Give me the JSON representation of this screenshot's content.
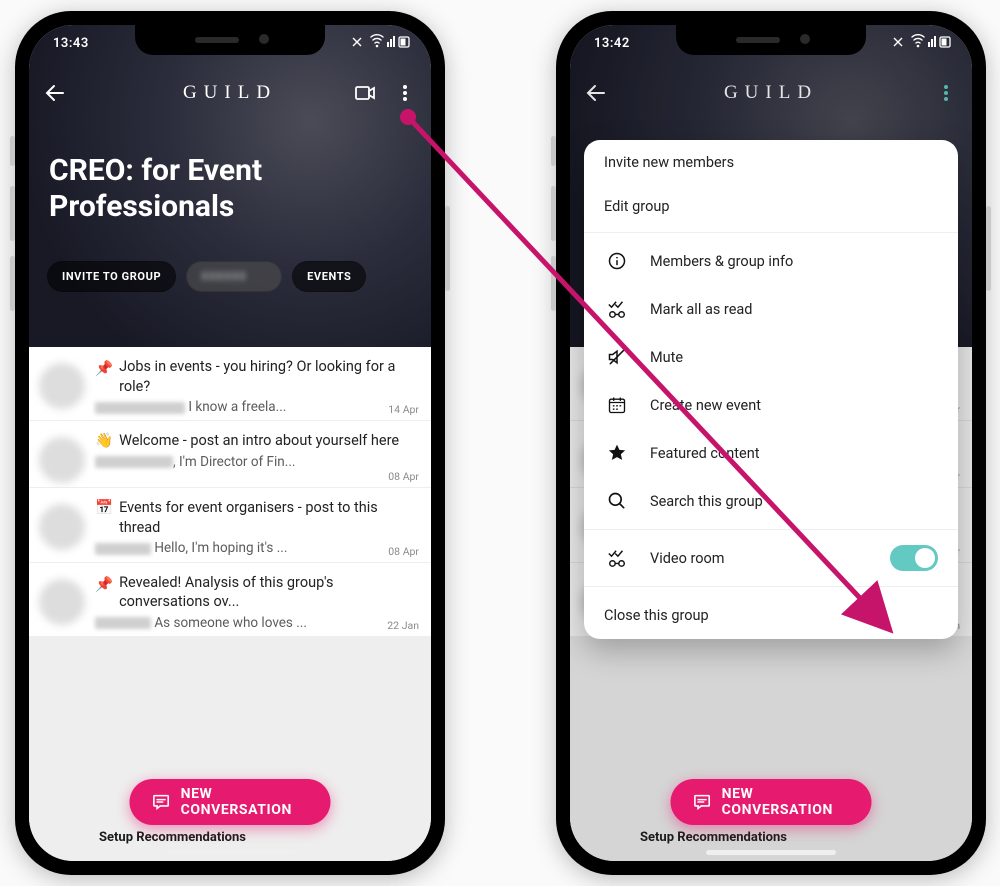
{
  "status": {
    "time_left": "13:43",
    "time_right": "13:42"
  },
  "brand": "GUILD",
  "hero_title_line1": "CREO: for Event",
  "hero_title_line2": "Professionals",
  "pills": {
    "invite": "INVITE TO GROUP",
    "events": "EVENTS"
  },
  "fab_label": "NEW CONVERSATION",
  "setup_hint": "Setup Recommendations",
  "posts": [
    {
      "title": "Jobs in events - you hiring? Or looking for a role?",
      "snippet": "I know a freela...",
      "date": "14 Apr",
      "icon": "pin"
    },
    {
      "title": "Welcome - post an intro about yourself here",
      "snippet": ", I'm Director of Fin...",
      "date": "08 Apr",
      "icon": "wave"
    },
    {
      "title": "Events for event organisers - post to this thread",
      "snippet": "Hello, I'm hoping it's ...",
      "date": "08 Apr",
      "icon": "cal"
    },
    {
      "title": "Revealed! Analysis of this group's conversations ov...",
      "snippet": "As someone who loves ...",
      "date": "22 Jan",
      "icon": "pin"
    }
  ],
  "menu": {
    "invite": "Invite new members",
    "edit": "Edit group",
    "info": "Members & group info",
    "mark_read": "Mark all as read",
    "mute": "Mute",
    "create_event": "Create new event",
    "featured": "Featured content",
    "search": "Search this group",
    "video_room": "Video room",
    "close": "Close this group"
  }
}
